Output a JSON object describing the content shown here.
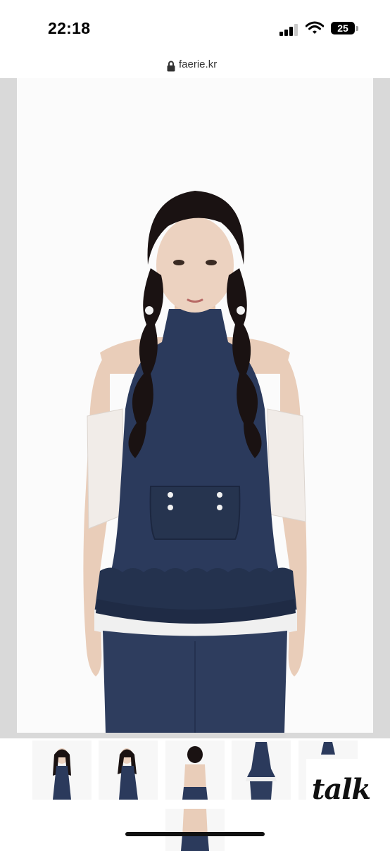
{
  "status_bar": {
    "time": "22:18",
    "battery": "25"
  },
  "browser": {
    "url": "faerie.kr"
  },
  "product": {
    "main_image": "model-wearing-navy-halter-top-with-ruffle-hem-and-lace-sleeves",
    "thumbnails": [
      "front-view",
      "side-view",
      "back-view",
      "top-detail",
      "top-only",
      "back-detail"
    ]
  },
  "chat_button": {
    "label": "talk"
  },
  "colors": {
    "navy": "#2b3a5c",
    "hair": "#1a1212",
    "skin": "#e8c9b4",
    "frame_gray": "#d9d9d9"
  }
}
